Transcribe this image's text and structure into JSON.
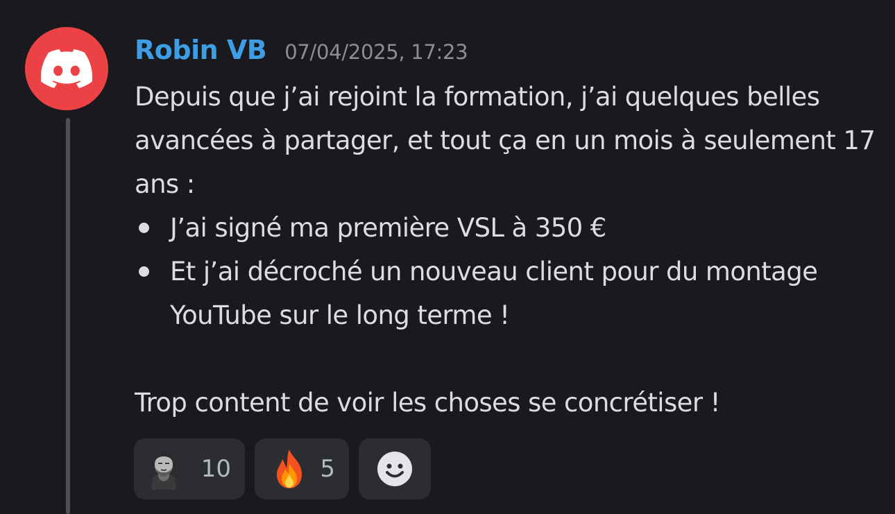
{
  "message": {
    "author": "Robin VB",
    "timestamp": "07/04/2025, 17:23",
    "author_color": "#3d9ee6",
    "avatar": {
      "icon": "discord-logo-icon",
      "background": "#ed4245"
    },
    "intro": "Depuis que j’ai rejoint la formation, j’ai quelques belles avancées à partager, et tout ça en un mois à seulement 17 ans :",
    "bullets": [
      "J’ai signé ma première VSL à 350 €",
      "Et j’ai décroché un nouveau client pour du montage YouTube sur le long terme !"
    ],
    "closing": "Trop content de voir les choses se concrétiser !"
  },
  "reactions": [
    {
      "icon": "gigachad-emoji-icon",
      "count": "10"
    },
    {
      "icon": "fire-emoji-icon",
      "count": "5"
    },
    {
      "icon": "add-reaction-smile-icon"
    }
  ]
}
